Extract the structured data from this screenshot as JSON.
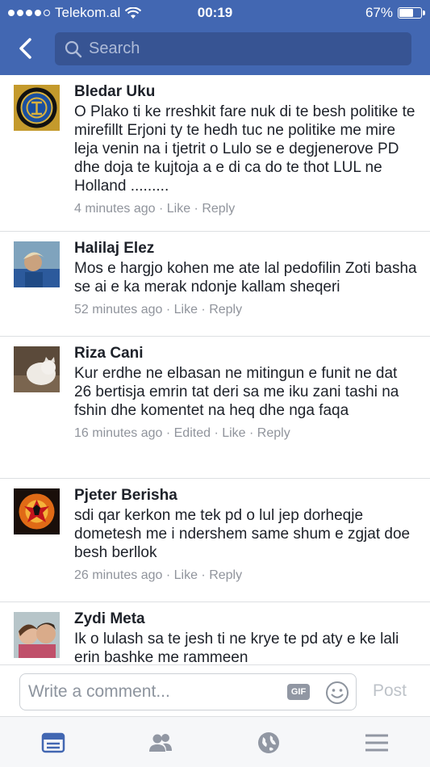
{
  "status_bar": {
    "carrier": "Telekom.al",
    "time": "00:19",
    "battery": "67%",
    "battery_level": 0.67
  },
  "header": {
    "search_placeholder": "Search"
  },
  "comments": [
    {
      "author": "Bledar Uku",
      "text": "O Plako ti ke rreshkit fare nuk di te besh politike te mirefillt Erjoni ty te hedh tuc ne politike me mire leja venin na i tjetrit o Lulo se e degjenerove PD dhe doja te kujtoja a e di ca do te thot LUL ne Holland .........",
      "time": "4 minutes ago",
      "like": "Like",
      "reply": "Reply"
    },
    {
      "author": "Halilaj Elez",
      "text": "Mos e hargjo kohen me ate lal pedofilin Zoti basha se ai e ka merak ndonje kallam sheqeri",
      "time": "52 minutes ago",
      "like": "Like",
      "reply": "Reply"
    },
    {
      "author": "Riza Cani",
      "text": "Kur erdhe ne elbasan ne mitingun e funit ne dat 26 bertisja emrin tat deri sa me iku zani tashi na fshin dhe komentet  na heq dhe nga faqa",
      "time": "16 minutes ago",
      "edited": "Edited",
      "like": "Like",
      "reply": "Reply"
    },
    {
      "author": "Pjeter Berisha",
      "text": "sdi qar kerkon me tek pd o lul jep dorheqje dometesh me i ndershem same shum e zgjat doe besh berllok",
      "time": "26 minutes ago",
      "like": "Like",
      "reply": "Reply"
    },
    {
      "author": "Zydi Meta",
      "text": "Ik o lulash sa te jesh ti ne krye te pd aty e ke lali erin bashke me rammeen",
      "time": "",
      "like": "",
      "reply": ""
    }
  ],
  "composer": {
    "placeholder": "Write a comment...",
    "gif_label": "GIF",
    "post_label": "Post"
  },
  "tabs": [
    "news-feed-icon",
    "friends-icon",
    "globe-icon",
    "menu-icon"
  ],
  "colors": {
    "brand": "#4267b2",
    "search_bg": "#375493",
    "tab_active": "#4267b2",
    "tab_inactive": "#9197a3"
  }
}
